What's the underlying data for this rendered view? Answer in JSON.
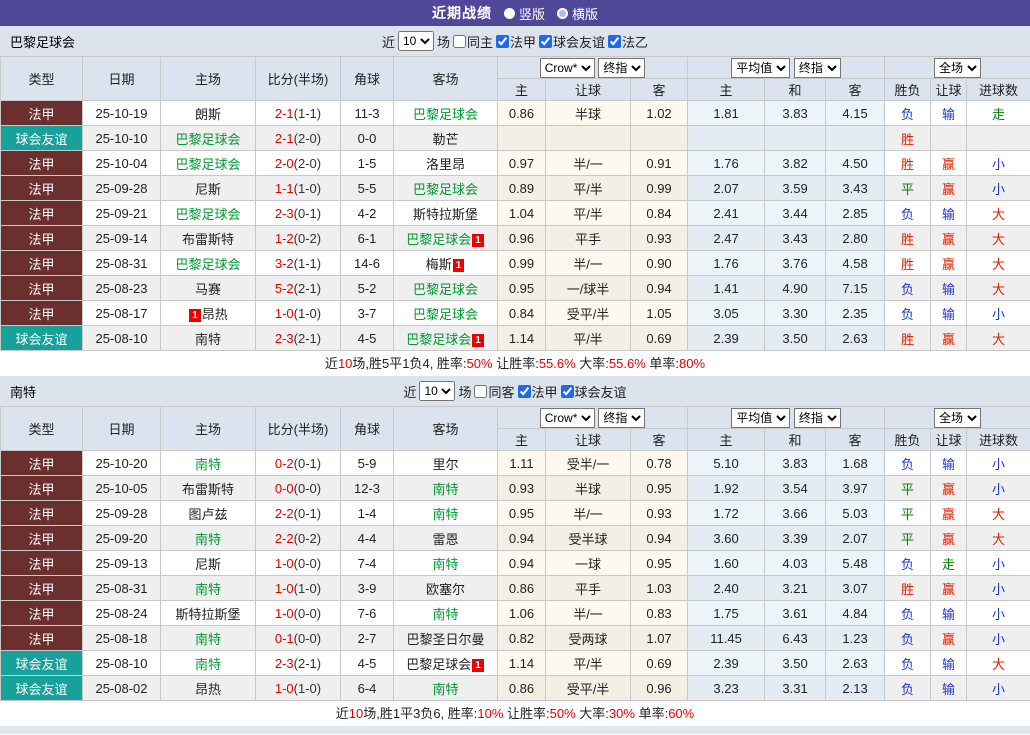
{
  "topbar": {
    "title": "近期战绩",
    "radios": [
      {
        "label": "竖版",
        "selected": true
      },
      {
        "label": "横版",
        "selected": false
      }
    ]
  },
  "table_headers": {
    "left": [
      "类型",
      "日期",
      "主场",
      "比分(半场)",
      "角球",
      "客场"
    ],
    "group1_dd1": "Crow*",
    "group1_dd2": "终指",
    "group1_cols": [
      "主",
      "让球",
      "客"
    ],
    "group2_dd1": "平均值",
    "group2_dd2": "终指",
    "group2_cols": [
      "主",
      "和",
      "客"
    ],
    "group3_dd": "全场",
    "group3_cols": [
      "胜负",
      "让球",
      "进球数"
    ]
  },
  "colors": {
    "topbar_bg": "#514798",
    "type_ligue1": "#6b302e",
    "type_friendly": "#18a09a",
    "team_green": "#009933",
    "score_red": "#e60000",
    "result_red": "#dd2200",
    "result_blue": "#2233cc",
    "result_green": "#008800"
  },
  "sections": [
    {
      "team": "巴黎足球会",
      "filter": {
        "prefix": "近",
        "count": "10",
        "suffix": "场",
        "checkboxes": [
          {
            "label": "同主",
            "checked": false
          },
          {
            "label": "法甲",
            "checked": true
          },
          {
            "label": "球会友谊",
            "checked": true
          },
          {
            "label": "法乙",
            "checked": true
          }
        ]
      },
      "rows": [
        {
          "type": "法甲",
          "date": "25-10-19",
          "home": {
            "name": "朗斯"
          },
          "score": "2-1",
          "half": "(1-1)",
          "corner": "11-3",
          "away": {
            "name": "巴黎足球会",
            "self": true
          },
          "o1": [
            "0.86",
            "半球",
            "1.02"
          ],
          "o2": [
            "1.81",
            "3.83",
            "4.15"
          ],
          "res": [
            [
              "负",
              "b"
            ],
            [
              "输",
              "b"
            ],
            [
              "走",
              "g"
            ]
          ]
        },
        {
          "type": "球会友谊",
          "date": "25-10-10",
          "home": {
            "name": "巴黎足球会",
            "self": true
          },
          "score": "2-1",
          "half": "(2-0)",
          "corner": "0-0",
          "away": {
            "name": "勒芒"
          },
          "o1": [
            "",
            "",
            ""
          ],
          "o2": [
            "",
            "",
            ""
          ],
          "res": [
            [
              "胜",
              "r"
            ],
            [
              "",
              ""
            ],
            [
              "",
              ""
            ]
          ]
        },
        {
          "type": "法甲",
          "date": "25-10-04",
          "home": {
            "name": "巴黎足球会",
            "self": true
          },
          "score": "2-0",
          "half": "(2-0)",
          "corner": "1-5",
          "away": {
            "name": "洛里昂"
          },
          "o1": [
            "0.97",
            "半/一",
            "0.91"
          ],
          "o2": [
            "1.76",
            "3.82",
            "4.50"
          ],
          "res": [
            [
              "胜",
              "r"
            ],
            [
              "赢",
              "r"
            ],
            [
              "小",
              "b"
            ]
          ]
        },
        {
          "type": "法甲",
          "date": "25-09-28",
          "home": {
            "name": "尼斯"
          },
          "score": "1-1",
          "half": "(1-0)",
          "corner": "5-5",
          "away": {
            "name": "巴黎足球会",
            "self": true
          },
          "o1": [
            "0.89",
            "平/半",
            "0.99"
          ],
          "o2": [
            "2.07",
            "3.59",
            "3.43"
          ],
          "res": [
            [
              "平",
              "g"
            ],
            [
              "赢",
              "r"
            ],
            [
              "小",
              "b"
            ]
          ]
        },
        {
          "type": "法甲",
          "date": "25-09-21",
          "home": {
            "name": "巴黎足球会",
            "self": true
          },
          "score": "2-3",
          "half": "(0-1)",
          "corner": "4-2",
          "away": {
            "name": "斯特拉斯堡"
          },
          "o1": [
            "1.04",
            "平/半",
            "0.84"
          ],
          "o2": [
            "2.41",
            "3.44",
            "2.85"
          ],
          "res": [
            [
              "负",
              "b"
            ],
            [
              "输",
              "b"
            ],
            [
              "大",
              "r"
            ]
          ]
        },
        {
          "type": "法甲",
          "date": "25-09-14",
          "home": {
            "name": "布雷斯特"
          },
          "score": "1-2",
          "half": "(0-2)",
          "corner": "6-1",
          "away": {
            "name": "巴黎足球会",
            "self": true,
            "badge": "1"
          },
          "o1": [
            "0.96",
            "平手",
            "0.93"
          ],
          "o2": [
            "2.47",
            "3.43",
            "2.80"
          ],
          "res": [
            [
              "胜",
              "r"
            ],
            [
              "赢",
              "r"
            ],
            [
              "大",
              "r"
            ]
          ]
        },
        {
          "type": "法甲",
          "date": "25-08-31",
          "home": {
            "name": "巴黎足球会",
            "self": true
          },
          "score": "3-2",
          "half": "(1-1)",
          "corner": "14-6",
          "away": {
            "name": "梅斯",
            "badge": "1"
          },
          "o1": [
            "0.99",
            "半/一",
            "0.90"
          ],
          "o2": [
            "1.76",
            "3.76",
            "4.58"
          ],
          "res": [
            [
              "胜",
              "r"
            ],
            [
              "赢",
              "r"
            ],
            [
              "大",
              "r"
            ]
          ]
        },
        {
          "type": "法甲",
          "date": "25-08-23",
          "home": {
            "name": "马赛"
          },
          "score": "5-2",
          "half": "(2-1)",
          "corner": "5-2",
          "away": {
            "name": "巴黎足球会",
            "self": true
          },
          "o1": [
            "0.95",
            "一/球半",
            "0.94"
          ],
          "o2": [
            "1.41",
            "4.90",
            "7.15"
          ],
          "res": [
            [
              "负",
              "b"
            ],
            [
              "输",
              "b"
            ],
            [
              "大",
              "r"
            ]
          ]
        },
        {
          "type": "法甲",
          "date": "25-08-17",
          "home": {
            "name": "昂热",
            "badge": "1",
            "badge_pos": "before"
          },
          "score": "1-0",
          "half": "(1-0)",
          "corner": "3-7",
          "away": {
            "name": "巴黎足球会",
            "self": true
          },
          "o1": [
            "0.84",
            "受平/半",
            "1.05"
          ],
          "o2": [
            "3.05",
            "3.30",
            "2.35"
          ],
          "res": [
            [
              "负",
              "b"
            ],
            [
              "输",
              "b"
            ],
            [
              "小",
              "b"
            ]
          ]
        },
        {
          "type": "球会友谊",
          "date": "25-08-10",
          "home": {
            "name": "南特"
          },
          "score": "2-3",
          "half": "(2-1)",
          "corner": "4-5",
          "away": {
            "name": "巴黎足球会",
            "self": true,
            "badge": "1"
          },
          "o1": [
            "1.14",
            "平/半",
            "0.69"
          ],
          "o2": [
            "2.39",
            "3.50",
            "2.63"
          ],
          "res": [
            [
              "胜",
              "r"
            ],
            [
              "赢",
              "r"
            ],
            [
              "大",
              "r"
            ]
          ]
        }
      ],
      "summary": [
        {
          "t": "近",
          "c": "k"
        },
        {
          "t": "10",
          "c": "r"
        },
        {
          "t": "场,胜5平1负4, 胜率:",
          "c": "k"
        },
        {
          "t": "50%",
          "c": "r"
        },
        {
          "t": " 让胜率:",
          "c": "k"
        },
        {
          "t": "55.6%",
          "c": "r"
        },
        {
          "t": " 大率:",
          "c": "k"
        },
        {
          "t": "55.6%",
          "c": "r"
        },
        {
          "t": " 单率:",
          "c": "k"
        },
        {
          "t": "80%",
          "c": "r"
        }
      ]
    },
    {
      "team": "南特",
      "filter": {
        "prefix": "近",
        "count": "10",
        "suffix": "场",
        "checkboxes": [
          {
            "label": "同客",
            "checked": false
          },
          {
            "label": "法甲",
            "checked": true
          },
          {
            "label": "球会友谊",
            "checked": true
          }
        ]
      },
      "rows": [
        {
          "type": "法甲",
          "date": "25-10-20",
          "home": {
            "name": "南特",
            "self": true
          },
          "score": "0-2",
          "half": "(0-1)",
          "corner": "5-9",
          "away": {
            "name": "里尔"
          },
          "o1": [
            "1.11",
            "受半/一",
            "0.78"
          ],
          "o2": [
            "5.10",
            "3.83",
            "1.68"
          ],
          "res": [
            [
              "负",
              "b"
            ],
            [
              "输",
              "b"
            ],
            [
              "小",
              "b"
            ]
          ]
        },
        {
          "type": "法甲",
          "date": "25-10-05",
          "home": {
            "name": "布雷斯特"
          },
          "score": "0-0",
          "half": "(0-0)",
          "corner": "12-3",
          "away": {
            "name": "南特",
            "self": true
          },
          "o1": [
            "0.93",
            "半球",
            "0.95"
          ],
          "o2": [
            "1.92",
            "3.54",
            "3.97"
          ],
          "res": [
            [
              "平",
              "g"
            ],
            [
              "赢",
              "r"
            ],
            [
              "小",
              "b"
            ]
          ]
        },
        {
          "type": "法甲",
          "date": "25-09-28",
          "home": {
            "name": "图卢兹"
          },
          "score": "2-2",
          "half": "(0-1)",
          "corner": "1-4",
          "away": {
            "name": "南特",
            "self": true
          },
          "o1": [
            "0.95",
            "半/一",
            "0.93"
          ],
          "o2": [
            "1.72",
            "3.66",
            "5.03"
          ],
          "res": [
            [
              "平",
              "g"
            ],
            [
              "赢",
              "r"
            ],
            [
              "大",
              "r"
            ]
          ]
        },
        {
          "type": "法甲",
          "date": "25-09-20",
          "home": {
            "name": "南特",
            "self": true
          },
          "score": "2-2",
          "half": "(0-2)",
          "corner": "4-4",
          "away": {
            "name": "雷恩"
          },
          "o1": [
            "0.94",
            "受半球",
            "0.94"
          ],
          "o2": [
            "3.60",
            "3.39",
            "2.07"
          ],
          "res": [
            [
              "平",
              "g"
            ],
            [
              "赢",
              "r"
            ],
            [
              "大",
              "r"
            ]
          ]
        },
        {
          "type": "法甲",
          "date": "25-09-13",
          "home": {
            "name": "尼斯"
          },
          "score": "1-0",
          "half": "(0-0)",
          "corner": "7-4",
          "away": {
            "name": "南特",
            "self": true
          },
          "o1": [
            "0.94",
            "一球",
            "0.95"
          ],
          "o2": [
            "1.60",
            "4.03",
            "5.48"
          ],
          "res": [
            [
              "负",
              "b"
            ],
            [
              "走",
              "g"
            ],
            [
              "小",
              "b"
            ]
          ]
        },
        {
          "type": "法甲",
          "date": "25-08-31",
          "home": {
            "name": "南特",
            "self": true
          },
          "score": "1-0",
          "half": "(1-0)",
          "corner": "3-9",
          "away": {
            "name": "欧塞尔"
          },
          "o1": [
            "0.86",
            "平手",
            "1.03"
          ],
          "o2": [
            "2.40",
            "3.21",
            "3.07"
          ],
          "res": [
            [
              "胜",
              "r"
            ],
            [
              "赢",
              "r"
            ],
            [
              "小",
              "b"
            ]
          ]
        },
        {
          "type": "法甲",
          "date": "25-08-24",
          "home": {
            "name": "斯特拉斯堡"
          },
          "score": "1-0",
          "half": "(0-0)",
          "corner": "7-6",
          "away": {
            "name": "南特",
            "self": true
          },
          "o1": [
            "1.06",
            "半/一",
            "0.83"
          ],
          "o2": [
            "1.75",
            "3.61",
            "4.84"
          ],
          "res": [
            [
              "负",
              "b"
            ],
            [
              "输",
              "b"
            ],
            [
              "小",
              "b"
            ]
          ]
        },
        {
          "type": "法甲",
          "date": "25-08-18",
          "home": {
            "name": "南特",
            "self": true
          },
          "score": "0-1",
          "half": "(0-0)",
          "corner": "2-7",
          "away": {
            "name": "巴黎圣日尔曼"
          },
          "o1": [
            "0.82",
            "受两球",
            "1.07"
          ],
          "o2": [
            "11.45",
            "6.43",
            "1.23"
          ],
          "res": [
            [
              "负",
              "b"
            ],
            [
              "赢",
              "r"
            ],
            [
              "小",
              "b"
            ]
          ]
        },
        {
          "type": "球会友谊",
          "date": "25-08-10",
          "home": {
            "name": "南特",
            "self": true
          },
          "score": "2-3",
          "half": "(2-1)",
          "corner": "4-5",
          "away": {
            "name": "巴黎足球会",
            "badge": "1"
          },
          "o1": [
            "1.14",
            "平/半",
            "0.69"
          ],
          "o2": [
            "2.39",
            "3.50",
            "2.63"
          ],
          "res": [
            [
              "负",
              "b"
            ],
            [
              "输",
              "b"
            ],
            [
              "大",
              "r"
            ]
          ]
        },
        {
          "type": "球会友谊",
          "date": "25-08-02",
          "home": {
            "name": "昂热"
          },
          "score": "1-0",
          "half": "(1-0)",
          "corner": "6-4",
          "away": {
            "name": "南特",
            "self": true
          },
          "o1": [
            "0.86",
            "受平/半",
            "0.96"
          ],
          "o2": [
            "3.23",
            "3.31",
            "2.13"
          ],
          "res": [
            [
              "负",
              "b"
            ],
            [
              "输",
              "b"
            ],
            [
              "小",
              "b"
            ]
          ]
        }
      ],
      "summary": [
        {
          "t": "近",
          "c": "k"
        },
        {
          "t": "10",
          "c": "r"
        },
        {
          "t": "场,胜1平3负6, 胜率:",
          "c": "k"
        },
        {
          "t": "10%",
          "c": "r"
        },
        {
          "t": " 让胜率:",
          "c": "k"
        },
        {
          "t": "50%",
          "c": "r"
        },
        {
          "t": " 大率:",
          "c": "k"
        },
        {
          "t": "30%",
          "c": "r"
        },
        {
          "t": " 单率:",
          "c": "k"
        },
        {
          "t": "60%",
          "c": "r"
        }
      ]
    }
  ]
}
